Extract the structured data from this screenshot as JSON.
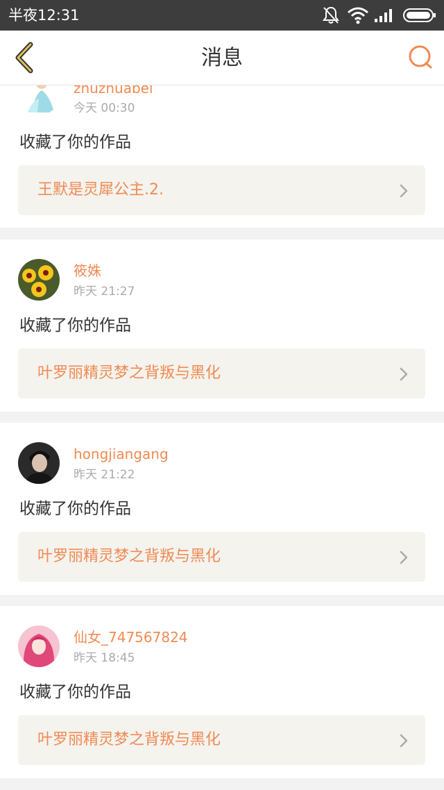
{
  "status_bar": {
    "time": "半夜12:31",
    "icons": [
      "bell-muted-icon",
      "wifi-icon",
      "signal-icon",
      "battery-icon"
    ]
  },
  "header": {
    "title": "消息",
    "back_icon": "chevron-left-icon",
    "search_icon": "search-icon"
  },
  "colors": {
    "accent": "#f08a52",
    "back_arrow": "#c8a23c",
    "status_bar_bg": "#3d3d3d"
  },
  "messages": [
    {
      "username": "znuznuabel",
      "time": "今天 00:30",
      "action": "收藏了你的作品",
      "work_title": "王默是灵犀公主.2."
    },
    {
      "username": "筱姝",
      "time": "昨天 21:27",
      "action": "收藏了你的作品",
      "work_title": "叶罗丽精灵梦之背叛与黑化"
    },
    {
      "username": "hongjiangang",
      "time": "昨天 21:22",
      "action": "收藏了你的作品",
      "work_title": "叶罗丽精灵梦之背叛与黑化"
    },
    {
      "username": "仙女_747567824",
      "time": "昨天 18:45",
      "action": "收藏了你的作品",
      "work_title": "叶罗丽精灵梦之背叛与黑化"
    }
  ]
}
